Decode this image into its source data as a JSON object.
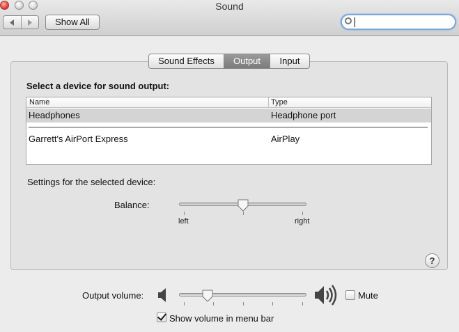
{
  "window": {
    "title": "Sound"
  },
  "toolbar": {
    "back_icon": "chevron-left-icon",
    "forward_icon": "chevron-right-icon",
    "show_all_label": "Show All",
    "search_value": "",
    "search_placeholder": ""
  },
  "tabs": [
    {
      "label": "Sound Effects",
      "active": false
    },
    {
      "label": "Output",
      "active": true
    },
    {
      "label": "Input",
      "active": false
    }
  ],
  "output": {
    "heading": "Select a device for sound output:",
    "columns": [
      "Name",
      "Type"
    ],
    "devices": [
      {
        "name": "Headphones",
        "type": "Headphone port",
        "selected": true
      },
      {
        "name": "Garrett's AirPort Express",
        "type": "AirPlay",
        "selected": false
      }
    ],
    "settings_heading": "Settings for the selected device:",
    "balance": {
      "label": "Balance:",
      "left_label": "left",
      "right_label": "right",
      "value": 0.5
    }
  },
  "help_label": "?",
  "volume": {
    "label": "Output volume:",
    "value": 0.2,
    "mute_label": "Mute",
    "mute_checked": false,
    "low_icon": "speaker-low-icon",
    "high_icon": "speaker-high-icon"
  },
  "menu_bar": {
    "label": "Show volume in menu bar",
    "checked": true
  },
  "colors": {
    "active_tab": "#8a8a8a",
    "selected_row": "#d4d4d4",
    "search_focus": "#7aa7de"
  }
}
